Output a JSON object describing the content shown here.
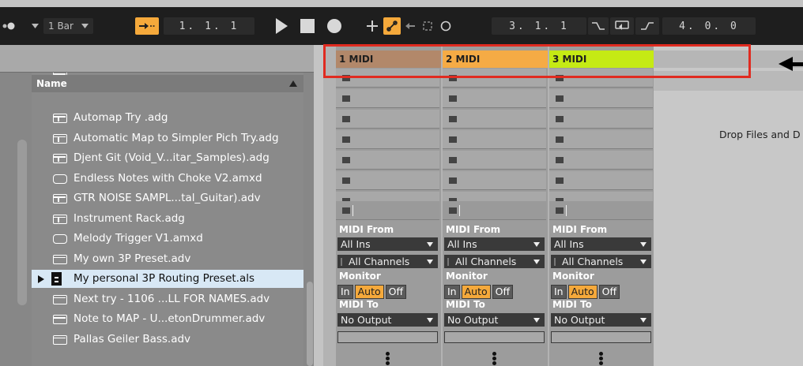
{
  "transport": {
    "quantize_label": "1 Bar",
    "follow_icon": "follow-arrow-icon",
    "position": "1.  1.  1",
    "loop_start": "3.  1.  1",
    "loop_length": "4.  0.  0"
  },
  "browser": {
    "column_header": "Name",
    "items": [
      {
        "label": "Automap Try .adg",
        "icon": "rack-icon"
      },
      {
        "label": "Automatic Map to Simpler Pich Try.adg",
        "icon": "rack-icon"
      },
      {
        "label": "Djent Git (Void_V...itar_Samples).adg",
        "icon": "rack-icon"
      },
      {
        "label": "Endless Notes with Choke V2.amxd",
        "icon": "max-device-icon"
      },
      {
        "label": "GTR NOISE SAMPL...tal_Guitar).adv",
        "icon": "rack-icon"
      },
      {
        "label": "Instrument Rack.adg",
        "icon": "rack-icon"
      },
      {
        "label": "Melody Trigger V1.amxd",
        "icon": "max-device-icon"
      },
      {
        "label": "My own 3P Preset.adv",
        "icon": "preset-icon"
      },
      {
        "label": "My personal 3P Routing Preset.als",
        "icon": "live-set-icon",
        "selected": true
      },
      {
        "label": "Next try - 1106 ...LL FOR NAMES.adv",
        "icon": "preset-icon"
      },
      {
        "label": "Note to MAP - U...etonDrummer.adv",
        "icon": "preset-icon"
      },
      {
        "label": "Pallas  Geiler Bass.adv",
        "icon": "preset-icon"
      }
    ]
  },
  "tracks": [
    {
      "name": "1 MIDI",
      "color": "#b2886a",
      "midi_from_label": "MIDI From",
      "midi_from": "All Ins",
      "channel": "All Channels",
      "monitor_label": "Monitor",
      "monitor_in": "In",
      "monitor_auto": "Auto",
      "monitor_off": "Off",
      "midi_to_label": "MIDI To",
      "midi_to": "No Output"
    },
    {
      "name": "2 MIDI",
      "color": "#f5ab45",
      "midi_from_label": "MIDI From",
      "midi_from": "All Ins",
      "channel": "All Channels",
      "monitor_label": "Monitor",
      "monitor_in": "In",
      "monitor_auto": "Auto",
      "monitor_off": "Off",
      "midi_to_label": "MIDI To",
      "midi_to": "No Output"
    },
    {
      "name": "3 MIDI",
      "color": "#c5ea14",
      "midi_from_label": "MIDI From",
      "midi_from": "All Ins",
      "channel": "All Channels",
      "monitor_label": "Monitor",
      "monitor_in": "In",
      "monitor_auto": "Auto",
      "monitor_off": "Off",
      "midi_to_label": "MIDI To",
      "midi_to": "No Output"
    }
  ],
  "drop_area": {
    "text": "Drop Files and D"
  },
  "colors": {
    "highlight": "#e02b20",
    "accent": "#f5a93b"
  }
}
